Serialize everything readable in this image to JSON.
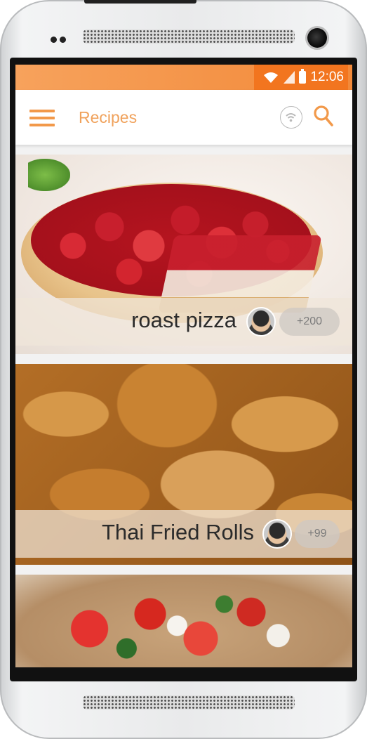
{
  "status_bar": {
    "time": "12:06",
    "icons": [
      "wifi-icon",
      "signal-icon",
      "battery-icon"
    ]
  },
  "app_bar": {
    "title": "Recipes",
    "icons": [
      "menu-icon",
      "wifi-icon",
      "search-icon"
    ]
  },
  "colors": {
    "accent": "#f2994a",
    "status_bar": "#f28a3a",
    "title": "#f0a25c"
  },
  "recipes": [
    {
      "title": "roast pizza",
      "count": "+200",
      "avatar": "user-avatar"
    },
    {
      "title": "Thai Fried Rolls",
      "count": "+99",
      "avatar": "user-avatar"
    },
    {
      "title": "",
      "count": "",
      "avatar": ""
    }
  ]
}
